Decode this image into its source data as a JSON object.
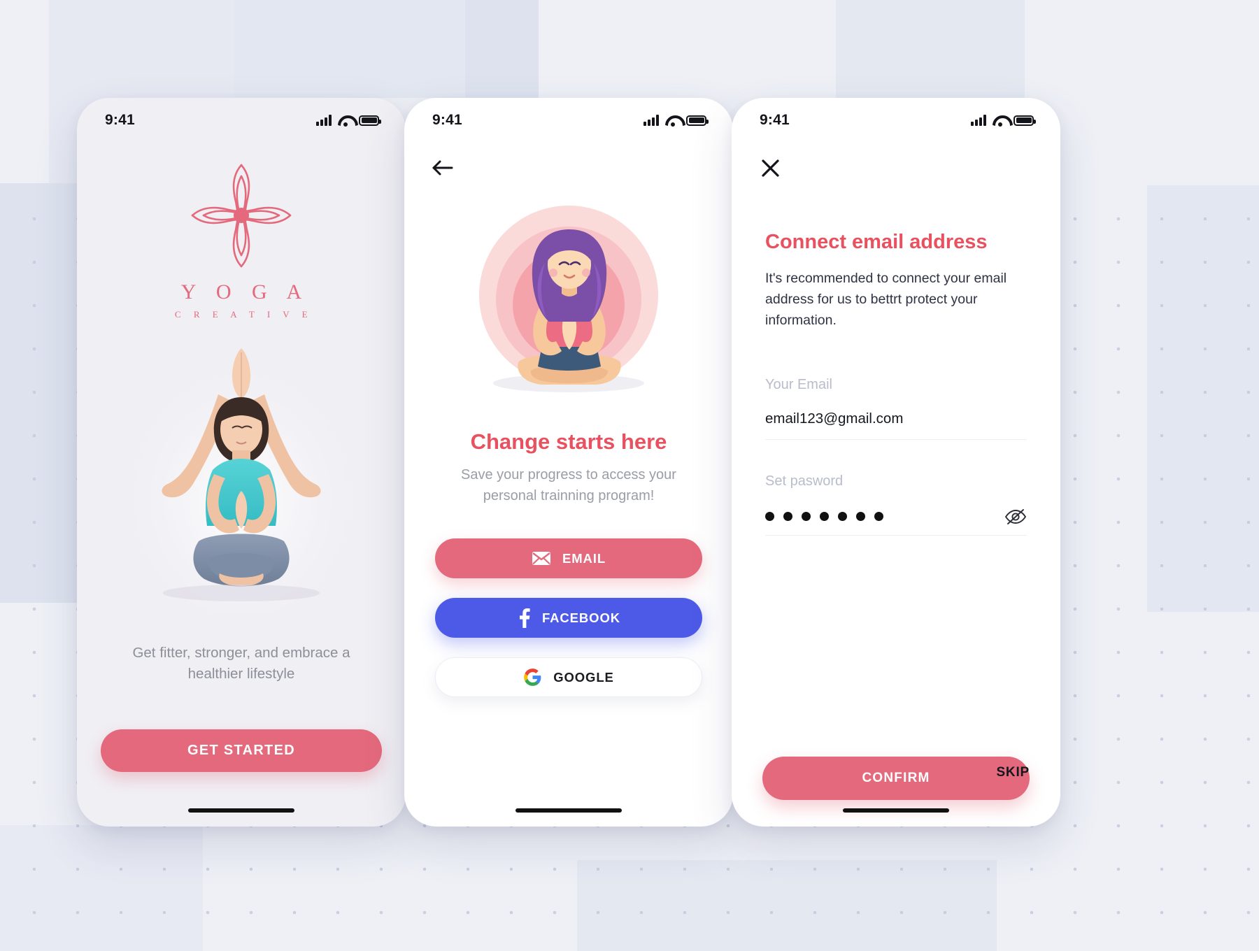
{
  "background": {
    "accent": "#e4697c",
    "page_bg": "#eef0f6",
    "block_color": "#dde2ee"
  },
  "screens": [
    {
      "id": "onboarding-welcome",
      "status_bar": {
        "time": "9:41",
        "signal_icon": "signal-bars-icon",
        "wifi_icon": "wifi-icon",
        "battery_icon": "battery-icon"
      },
      "logo_icon": "yoga-ornamental-cross-logo",
      "brand": {
        "title": "Y O G A",
        "subtitle": "C R E A T I V E"
      },
      "hero_image": "woman-in-lotus-pose-photo",
      "tagline": "Get fitter, stronger, and embrace a healthier lifestyle",
      "cta": {
        "label": "GET STARTED",
        "color": "#e4697c"
      }
    },
    {
      "id": "signup-options",
      "status_bar": {
        "time": "9:41",
        "signal_icon": "signal-bars-icon",
        "wifi_icon": "wifi-icon",
        "battery_icon": "battery-icon"
      },
      "back_icon": "arrow-left-icon",
      "illustration": "meditating-woman-illustration",
      "headline": "Change starts here",
      "subhead": "Save your progress to access your personal trainning program!",
      "buttons": [
        {
          "label": "EMAIL",
          "icon": "envelope-icon",
          "color": "#e4697c"
        },
        {
          "label": "FACEBOOK",
          "icon": "facebook-icon",
          "color": "#4d5ae8"
        },
        {
          "label": "GOOGLE",
          "icon": "google-icon",
          "color": "#ffffff"
        }
      ]
    },
    {
      "id": "connect-email",
      "status_bar": {
        "time": "9:41",
        "signal_icon": "signal-bars-icon",
        "wifi_icon": "wifi-icon",
        "battery_icon": "battery-icon"
      },
      "close_icon": "close-x-icon",
      "title": "Connect email address",
      "description": "It's recommended to connect your email address for us to bettrt protect your information.",
      "email_field": {
        "label": "Your Email",
        "value": "email123@gmail.com"
      },
      "password_field": {
        "label": "Set pasword",
        "masked_value": "•••••••",
        "dot_count": 7,
        "toggle_icon": "eye-off-icon"
      },
      "confirm": {
        "label": "CONFIRM",
        "color": "#e4697c"
      },
      "skip": {
        "label": "SKIP"
      }
    }
  ]
}
